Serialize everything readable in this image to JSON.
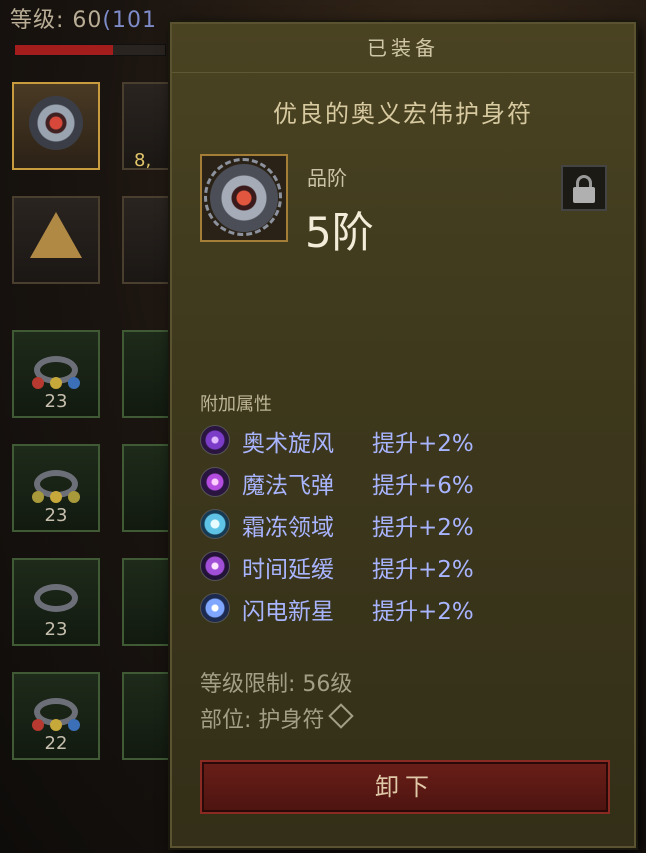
{
  "colors": {
    "panel_bg": "#3e391d",
    "attribute_text": "#a9b4ff",
    "requirement_text": "#a39e86",
    "button_bg": "#5a1a14"
  },
  "player": {
    "level_text": "等级: 60",
    "paragon_text": "(101",
    "health_fraction": 0.65
  },
  "inventory": {
    "gold_partial": "8,",
    "slot_levels": [
      "23",
      "23",
      "23",
      "22"
    ]
  },
  "tooltip": {
    "header": "已装备",
    "item_name": "优良的奥义宏伟护身符",
    "item_icon": "amulet-icon",
    "grade_label": "品阶",
    "grade_value": "5阶",
    "lock_icon": "lock-icon",
    "attributes_label": "附加属性",
    "attributes": [
      {
        "icon": "arcane-whirlwind-icon",
        "name": "奥术旋风",
        "bonus": "提升+2%"
      },
      {
        "icon": "magic-missile-icon",
        "name": "魔法飞弹",
        "bonus": "提升+6%"
      },
      {
        "icon": "frost-domain-icon",
        "name": "霜冻领域",
        "bonus": "提升+2%"
      },
      {
        "icon": "time-slow-icon",
        "name": "时间延缓",
        "bonus": "提升+2%"
      },
      {
        "icon": "frost-nova-icon",
        "name": "闪电新星",
        "bonus": "提升+2%"
      }
    ],
    "level_requirement": "等级限制: 56级",
    "slot_text": "部位: 护身符",
    "unequip_button": "卸下"
  }
}
